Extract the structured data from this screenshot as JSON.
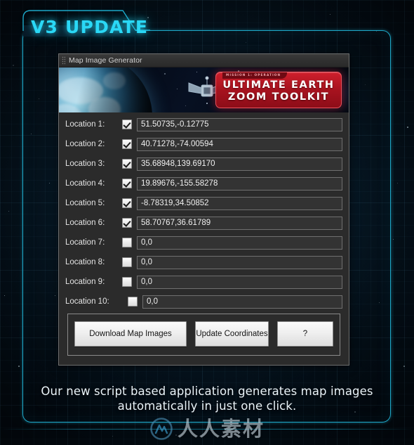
{
  "page": {
    "title": "V3 UPDATE",
    "caption_line1": "Our new script based application generates map images",
    "caption_line2": "automatically in just one click."
  },
  "window": {
    "title": "Map Image Generator",
    "grip_icon": "grip-dots-icon"
  },
  "banner": {
    "logo_tab": "MISSION 1: OPERATION",
    "logo_line1": "ULTIMATE EARTH",
    "logo_line2": "ZOOM TOOLKIT",
    "earth_icon": "earth-globe-icon",
    "satellite_icon": "satellite-icon"
  },
  "form": {
    "locations": [
      {
        "label": "Location 1:",
        "checked": true,
        "value": "51.50735,-0.12775"
      },
      {
        "label": "Location 2:",
        "checked": true,
        "value": "40.71278,-74.00594"
      },
      {
        "label": "Location 3:",
        "checked": true,
        "value": "35.68948,139.69170"
      },
      {
        "label": "Location 4:",
        "checked": true,
        "value": "19.89676,-155.58278"
      },
      {
        "label": "Location 5:",
        "checked": true,
        "value": "-8.78319,34.50852"
      },
      {
        "label": "Location 6:",
        "checked": true,
        "value": "58.70767,36.61789"
      },
      {
        "label": "Location 7:",
        "checked": false,
        "value": "0,0"
      },
      {
        "label": "Location 8:",
        "checked": false,
        "value": "0,0"
      },
      {
        "label": "Location 9:",
        "checked": false,
        "value": "0,0"
      },
      {
        "label": "Location 10:",
        "checked": false,
        "value": "0,0"
      }
    ]
  },
  "buttons": {
    "download": "Download Map Images",
    "update": "Update Coordinates",
    "help": "?"
  },
  "watermark": {
    "text": "人人素材",
    "mark_icon": "rr-circle-logo-icon"
  },
  "colors": {
    "accent_cyan": "#2ad8f6",
    "frame_cyan": "#1ea8c8",
    "logo_red": "#cf1f2c",
    "window_gray": "#2b2b2b",
    "background_navy": "#071a28"
  }
}
